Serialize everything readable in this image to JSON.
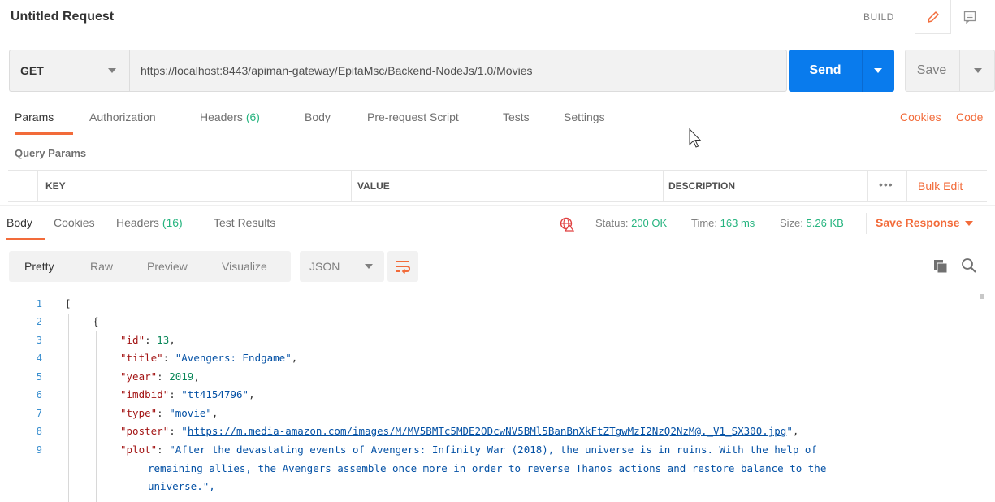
{
  "header": {
    "title": "Untitled Request",
    "build_label": "BUILD",
    "edit_icon": "pencil-icon",
    "comment_icon": "comment-icon"
  },
  "request": {
    "method": "GET",
    "url": "https://localhost:8443/apiman-gateway/EpitaMsc/Backend-NodeJs/1.0/Movies",
    "send_label": "Send",
    "save_label": "Save"
  },
  "request_tabs": {
    "params": "Params",
    "authorization": "Authorization",
    "headers": "Headers",
    "headers_count": "(6)",
    "body": "Body",
    "pre_request": "Pre-request Script",
    "tests": "Tests",
    "settings": "Settings",
    "cookies": "Cookies",
    "code": "Code"
  },
  "query_params": {
    "title": "Query Params",
    "columns": [
      "KEY",
      "VALUE",
      "DESCRIPTION"
    ],
    "more": "•••",
    "bulk_edit": "Bulk Edit"
  },
  "response_tabs": {
    "body": "Body",
    "cookies": "Cookies",
    "headers": "Headers",
    "headers_count": "(16)",
    "test_results": "Test Results"
  },
  "status": {
    "status_label": "Status:",
    "status_value": "200 OK",
    "time_label": "Time:",
    "time_value": "163 ms",
    "size_label": "Size:",
    "size_value": "5.26 KB",
    "save_response": "Save Response"
  },
  "view": {
    "pretty": "Pretty",
    "raw": "Raw",
    "preview": "Preview",
    "visualize": "Visualize",
    "format": "JSON"
  },
  "code": {
    "line_numbers": [
      "1",
      "2",
      "3",
      "4",
      "5",
      "6",
      "7",
      "8",
      "9"
    ],
    "open_bracket": "[",
    "open_brace": "{",
    "id_key": "\"id\"",
    "id_value": "13",
    "title_key": "\"title\"",
    "title_value": "\"Avengers: Endgame\"",
    "year_key": "\"year\"",
    "year_value": "2019",
    "imdbid_key": "\"imdbid\"",
    "imdbid_value": "\"tt4154796\"",
    "type_key": "\"type\"",
    "type_value": "\"movie\"",
    "poster_key": "\"poster\"",
    "poster_value": "https://m.media-amazon.com/images/M/MV5BMTc5MDE2ODcwNV5BMl5BanBnXkFtZTgwMzI2NzQ2NzM@._V1_SX300.jpg",
    "plot_key": "\"plot\"",
    "plot_line1": "\"After the devastating events of Avengers: Infinity War (2018), the universe is in ruins. With the help of",
    "plot_line2": "remaining allies, the Avengers assemble once more in order to reverse Thanos actions and restore balance to the",
    "plot_line3": "universe.\","
  },
  "colors": {
    "accent": "#f26b3a",
    "send_blue": "#097bed",
    "success_green": "#26b47f"
  }
}
